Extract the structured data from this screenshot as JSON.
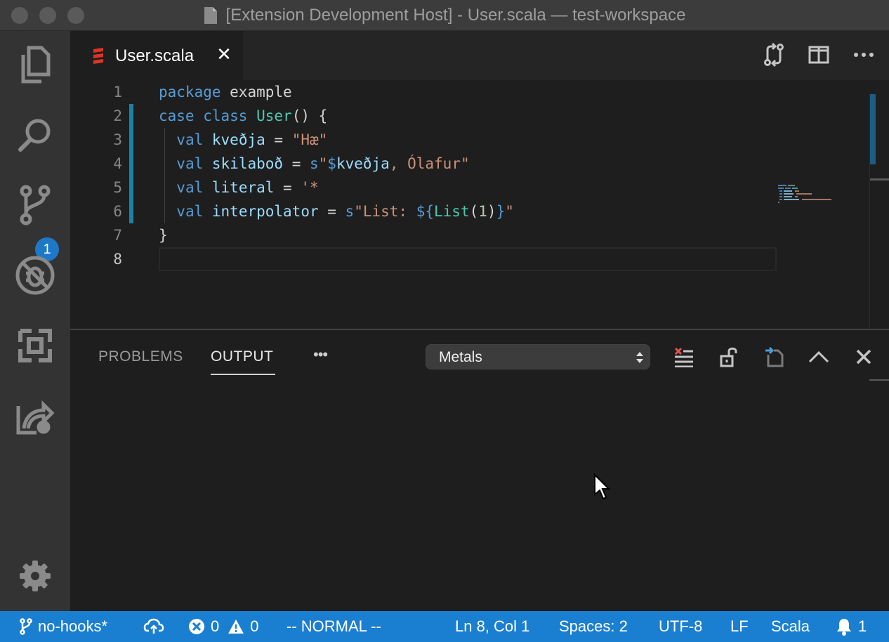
{
  "window": {
    "title": "[Extension Development Host] - User.scala — test-workspace"
  },
  "activity_bar": {
    "items": [
      {
        "name": "explorer",
        "icon": "files-icon"
      },
      {
        "name": "search",
        "icon": "search-icon"
      },
      {
        "name": "source-control",
        "icon": "source-control-icon",
        "badge": "1"
      },
      {
        "name": "debug",
        "icon": "debug-disabled-icon"
      },
      {
        "name": "extensions",
        "icon": "extensions-icon"
      },
      {
        "name": "remote",
        "icon": "live-share-icon"
      }
    ],
    "settings_icon": "gear-icon"
  },
  "tabs": [
    {
      "label": "User.scala",
      "icon": "scala-icon",
      "active": true
    }
  ],
  "editor_actions": [
    "compare-changes-icon",
    "split-editor-icon",
    "more-actions-icon"
  ],
  "editor": {
    "line_numbers": [
      "1",
      "2",
      "3",
      "4",
      "5",
      "6",
      "7",
      "8"
    ],
    "active_line": "8"
  },
  "panel": {
    "tabs": [
      {
        "label": "PROBLEMS",
        "active": false
      },
      {
        "label": "OUTPUT",
        "active": true
      }
    ],
    "more_label": "•••",
    "output_channel": "Metals",
    "actions": [
      "clear-output-icon",
      "lock-scroll-icon",
      "open-log-icon",
      "maximize-panel-icon",
      "close-panel-icon"
    ]
  },
  "status_bar": {
    "branch": "no-hooks*",
    "sync_icon": "cloud-upload-icon",
    "errors": "0",
    "warnings": "0",
    "mode": "-- NORMAL --",
    "position": "Ln 8, Col 1",
    "indentation": "Spaces: 2",
    "encoding": "UTF-8",
    "eol": "LF",
    "language": "Scala",
    "notifications": "1"
  },
  "colors": {
    "status_bar": "#1b7fd1",
    "badge": "#1e78c8",
    "keyword": "#569cd6",
    "type": "#4ec9b0",
    "string": "#ce9178"
  }
}
